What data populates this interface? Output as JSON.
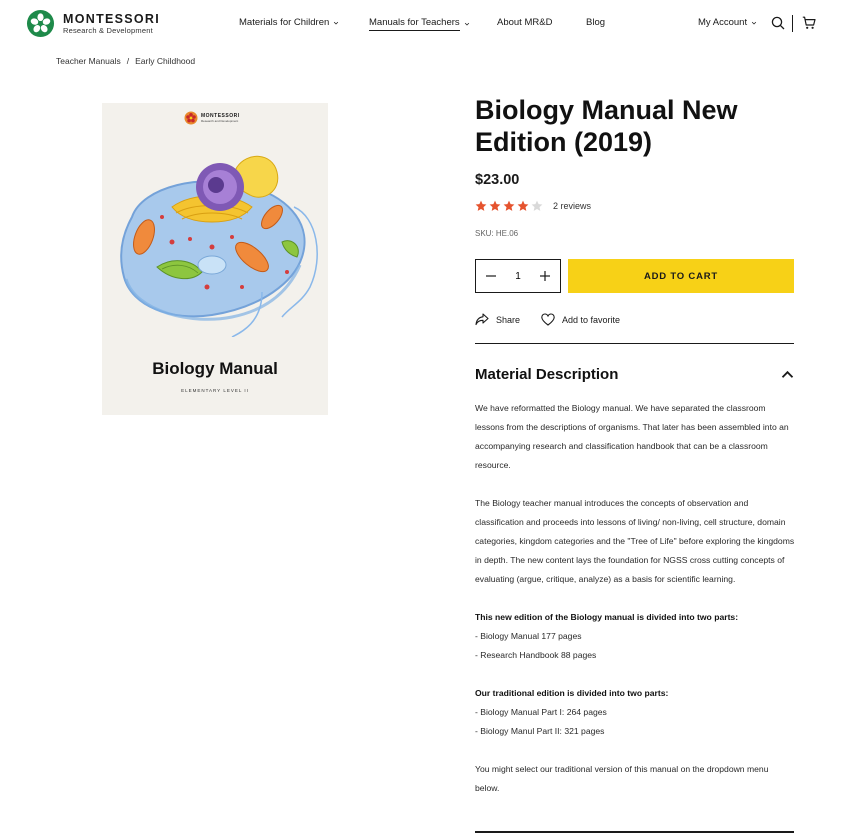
{
  "brand": {
    "name": "MONTESSORI",
    "tagline": "Research & Development",
    "colors": {
      "green": "#1e8a4a",
      "accent": "#f7d117",
      "star": "#e5532e",
      "star_empty": "#d9d9d9"
    }
  },
  "nav": {
    "items": [
      {
        "label": "Materials for Children",
        "has_dropdown": true
      },
      {
        "label": "Manuals for Teachers",
        "has_dropdown": true,
        "active": true
      },
      {
        "label": "About MR&D",
        "has_dropdown": false
      },
      {
        "label": "Blog",
        "has_dropdown": false
      }
    ],
    "account_label": "My Account",
    "icons": [
      "search-icon",
      "cart-icon"
    ]
  },
  "breadcrumb": {
    "items": [
      "Teacher Manuals",
      "Early Childhood"
    ],
    "separator": "/"
  },
  "cover": {
    "brand": "MONTESSORI",
    "brand_sub": "Research and Development",
    "title": "Biology Manual",
    "level": "ELEMENTARY LEVEL II"
  },
  "product": {
    "title": "Biology Manual New Edition (2019)",
    "price": "$23.00",
    "rating": 4,
    "rating_max": 5,
    "reviews": "2 reviews",
    "sku": "SKU: HE.06",
    "quantity": "1",
    "add_to_cart": "ADD TO CART",
    "share": "Share",
    "favorite": "Add to favorite"
  },
  "description": {
    "heading": "Material Description",
    "para1": "We have reformatted the Biology manual. We have separated the classroom lessons from the descriptions of organisms. That later has been assembled into an accompanying research and classification handbook that can be a classroom resource.",
    "para2": "The Biology teacher manual introduces the concepts of observation and classification and proceeds into lessons of living/ non-living, cell structure, domain categories, kingdom categories and the \"Tree of Life\" before exploring the kingdoms in depth. The new content lays the foundation for NGSS cross cutting concepts of evaluating (argue, critique, analyze) as a basis for scientific learning.",
    "new_edition_heading": "This new edition of the Biology manual is divided into two parts:",
    "new_edition_items": [
      "- Biology Manual 177 pages",
      "- Research Handbook 88 pages"
    ],
    "traditional_heading": "Our traditional edition is divided into two parts:",
    "traditional_items": [
      "- Biology Manual Part I: 264 pages",
      "- Biology Manul Part II: 321 pages"
    ],
    "closing": "You might select our traditional version of this manual on the dropdown menu below."
  }
}
